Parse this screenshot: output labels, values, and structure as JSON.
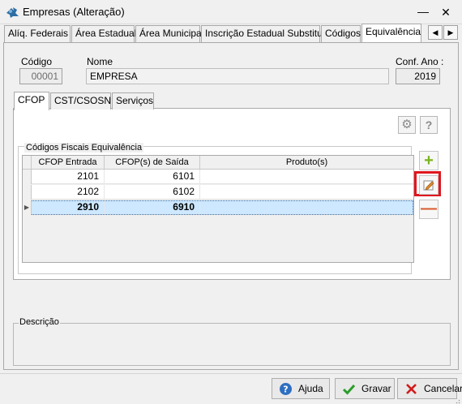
{
  "window": {
    "title": "Empresas (Alteração)",
    "minimize_glyph": "—",
    "close_glyph": "✕"
  },
  "main_tabs": [
    {
      "label": "Alíq. Federais"
    },
    {
      "label": "Área Estadual"
    },
    {
      "label": "Área Municipal"
    },
    {
      "label": "Inscrição Estadual Substituto"
    },
    {
      "label": "Códigos"
    },
    {
      "label": "Equivalência",
      "active": true
    }
  ],
  "tab_scroll": {
    "left": "◀",
    "right": "▶"
  },
  "header": {
    "codigo_label": "Código",
    "codigo_value": "00001",
    "nome_label": "Nome",
    "nome_value": "EMPRESA",
    "conf_ano_label": "Conf. Ano :",
    "conf_ano_value": "2019"
  },
  "inner_tabs": [
    {
      "label": "CFOP",
      "active": true
    },
    {
      "label": "CST/CSOSN"
    },
    {
      "label": "Serviços"
    }
  ],
  "toolbar": {
    "settings_icon": "⚙",
    "help_label": "?"
  },
  "group_title": "Códigos Fiscais Equivalência",
  "grid": {
    "columns": [
      "CFOP Entrada",
      "CFOP(s) de Saída",
      "Produto(s)"
    ],
    "rows": [
      {
        "entrada": "2101",
        "saida": "6101",
        "produto": ""
      },
      {
        "entrada": "2102",
        "saida": "6102",
        "produto": ""
      },
      {
        "entrada": "2910",
        "saida": "6910",
        "produto": "",
        "selected": true
      }
    ],
    "row_indicator": "▶"
  },
  "side_buttons": {
    "add": "+",
    "remove": "—"
  },
  "descricao_label": "Descrição",
  "buttons": {
    "help": "Ajuda",
    "save": "Gravar",
    "cancel": "Cancelar"
  },
  "colors": {
    "accent_highlight": "#e0161e",
    "selected_row": "#cde8ff",
    "add_green": "#7ab51d",
    "remove_orange": "#d85a2b"
  }
}
